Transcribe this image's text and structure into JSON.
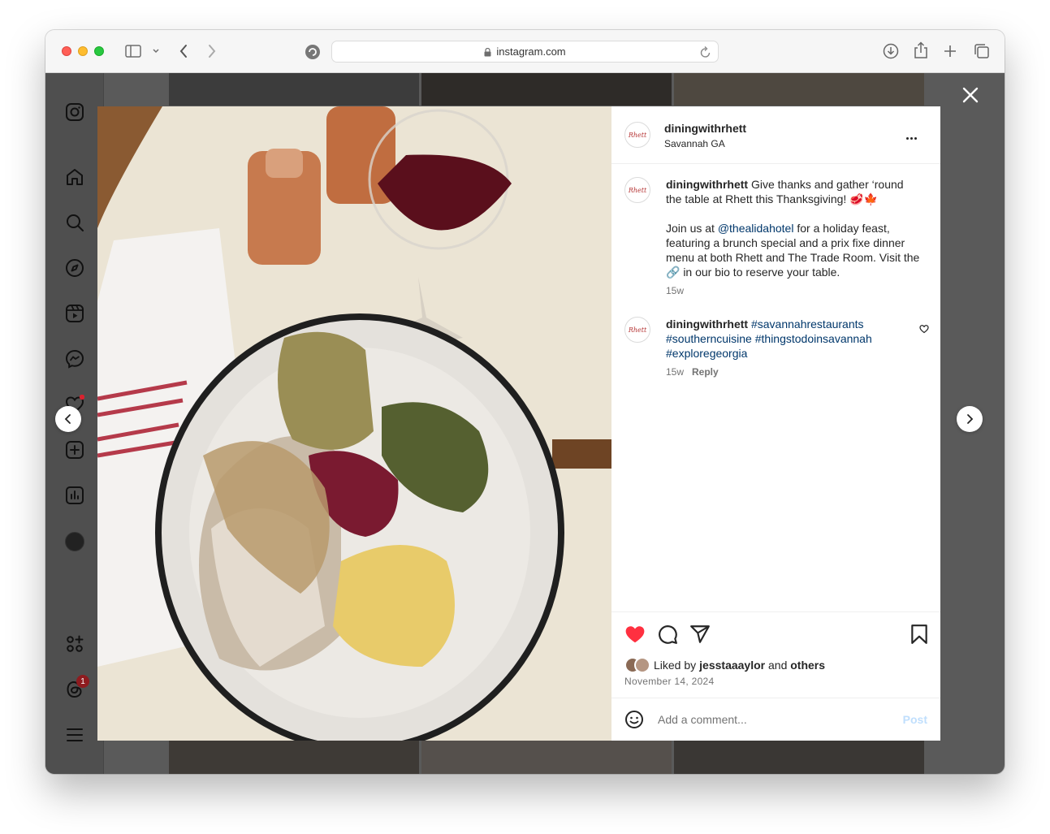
{
  "browser": {
    "url": "instagram.com",
    "icons": [
      "sidebar-toggle-icon",
      "chevron-down-icon",
      "back-arrow-icon",
      "forward-arrow-icon",
      "privacy-shield-icon",
      "lock-icon",
      "reload-icon",
      "download-icon",
      "share-icon",
      "new-tab-plus-icon",
      "tab-overview-icon"
    ]
  },
  "sidebar": {
    "items": [
      "instagram-logo-icon",
      "home-icon",
      "search-icon",
      "explore-icon",
      "reels-icon",
      "messenger-icon",
      "notifications-heart-icon",
      "create-plus-icon",
      "insights-icon",
      "profile-avatar",
      "also-from-meta-icon",
      "threads-icon",
      "menu-icon"
    ],
    "threads_badge": "1"
  },
  "post": {
    "author": "diningwithrhett",
    "location": "Savannah GA",
    "avatar_text": "Rhett",
    "caption": {
      "username": "diningwithrhett",
      "line1": "Give thanks and gather ‘round the table at Rhett this Thanksgiving! 🥩🍁",
      "line2_pre": "Join us at ",
      "mention": "@thealidahotel",
      "line2_post": " for a holiday feast, featuring a brunch special and a prix fixe dinner menu at both Rhett and The Trade Room. Visit the 🔗 in our bio to reserve your table.",
      "time": "15w"
    },
    "comment2": {
      "username": "diningwithrhett",
      "hashtags": "#savannahrestaurants #southerncuisine #thingstodoinsavannah #exploregeorgia",
      "time": "15w",
      "reply_label": "Reply"
    },
    "likes": {
      "prefix": "Liked by ",
      "user": "jesstaaaylor",
      "middle": " and ",
      "others": "others"
    },
    "date": "November 14, 2024",
    "comment_placeholder": "Add a comment...",
    "post_label": "Post"
  },
  "colors": {
    "like_red": "#ff3040",
    "link_blue": "#00376b",
    "post_disabled": "#c0dffd"
  }
}
